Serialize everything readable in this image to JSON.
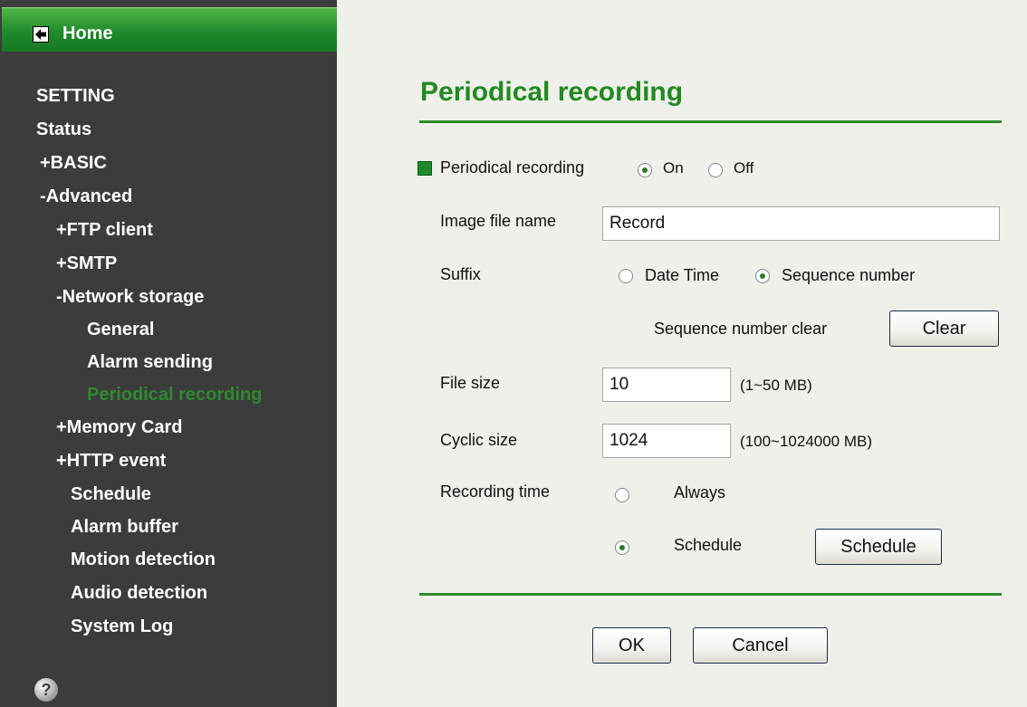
{
  "sidebar": {
    "home_label": "Home",
    "items": [
      {
        "label": "SETTING"
      },
      {
        "label": "Status"
      },
      {
        "label": "+BASIC"
      },
      {
        "label": "-Advanced"
      },
      {
        "label": "+FTP client"
      },
      {
        "label": "+SMTP"
      },
      {
        "label": "-Network storage"
      },
      {
        "label": "General"
      },
      {
        "label": "Alarm sending"
      },
      {
        "label": "Periodical recording"
      },
      {
        "label": "+Memory Card"
      },
      {
        "label": "+HTTP event"
      },
      {
        "label": "Schedule"
      },
      {
        "label": "Alarm buffer"
      },
      {
        "label": "Motion detection"
      },
      {
        "label": "Audio detection"
      },
      {
        "label": "System Log"
      }
    ],
    "active_item": "Periodical recording",
    "help_glyph": "?"
  },
  "main": {
    "title": "Periodical recording",
    "periodical": {
      "label": "Periodical recording",
      "on_label": "On",
      "off_label": "Off",
      "selected": "On"
    },
    "image_file_name": {
      "label": "Image file name",
      "value": "Record"
    },
    "suffix": {
      "label": "Suffix",
      "date_time_label": "Date Time",
      "sequence_label": "Sequence number",
      "selected": "Sequence number"
    },
    "sequence_clear": {
      "label": "Sequence number clear",
      "button": "Clear"
    },
    "file_size": {
      "label": "File size",
      "value": "10",
      "range": "(1~50 MB)"
    },
    "cyclic_size": {
      "label": "Cyclic size",
      "value": "1024",
      "range": "(100~1024000 MB)"
    },
    "recording_time": {
      "label": "Recording time",
      "always_label": "Always",
      "schedule_label": "Schedule",
      "schedule_button": "Schedule",
      "selected": "Schedule"
    },
    "ok_button": "OK",
    "cancel_button": "Cancel"
  },
  "colors": {
    "sidebar_bg": "#3c3c3c",
    "accent_green": "#218a21",
    "content_bg": "#eef0e9"
  },
  "icons": {
    "home": "back-arrow-icon",
    "help": "help-icon",
    "bullet": "square-bullet-icon"
  }
}
